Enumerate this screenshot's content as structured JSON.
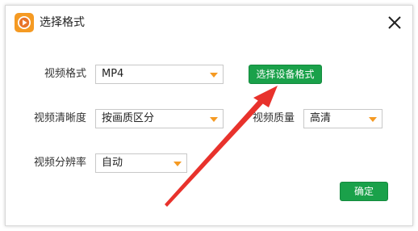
{
  "dialog": {
    "title": "选择格式",
    "icon": "play-icon",
    "close_icon": "close-icon"
  },
  "form": {
    "video_format": {
      "label": "视频格式",
      "value": "MP4"
    },
    "select_device_button": "选择设备格式",
    "video_clarity": {
      "label": "视频清晰度",
      "value": "按画质区分"
    },
    "video_quality": {
      "label": "视频质量",
      "value": "高清"
    },
    "video_resolution": {
      "label": "视频分辨率",
      "value": "自动"
    },
    "confirm_button": "确定"
  },
  "colors": {
    "accent_green": "#1aa14a",
    "dropdown_arrow": "#f59a23",
    "annotation_arrow": "#e8322c"
  }
}
